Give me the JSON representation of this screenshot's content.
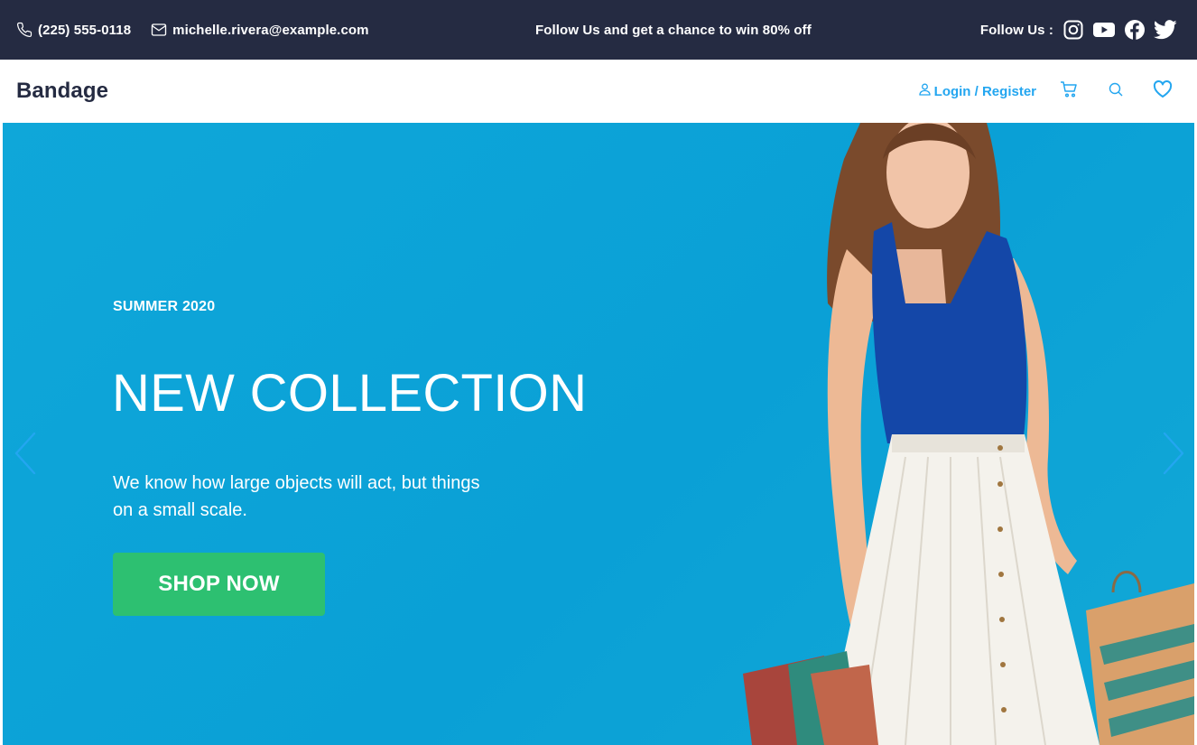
{
  "topbar": {
    "phone": "(225) 555-0118",
    "email": "michelle.rivera@example.com",
    "promo": "Follow Us and get a chance to win 80% off",
    "follow_label": "Follow Us :",
    "social_icons": [
      "instagram-icon",
      "youtube-icon",
      "facebook-icon",
      "twitter-icon"
    ]
  },
  "nav": {
    "brand": "Bandage",
    "login_label": "Login / Register",
    "icons": [
      "user-icon",
      "cart-icon",
      "search-icon",
      "heart-icon"
    ]
  },
  "hero": {
    "subtitle": "SUMMER 2020",
    "headline": "NEW COLLECTION",
    "description": "We know how large objects will act, but things on a small scale.",
    "cta_label": "SHOP NOW",
    "arrows": [
      "chevron-left-icon",
      "chevron-right-icon"
    ]
  },
  "colors": {
    "topbar_bg": "#252b42",
    "brand_text": "#252b42",
    "accent_blue": "#23a6f0",
    "hero_bg": "#0aa0d6",
    "cta_green": "#2dc071",
    "white": "#ffffff"
  }
}
